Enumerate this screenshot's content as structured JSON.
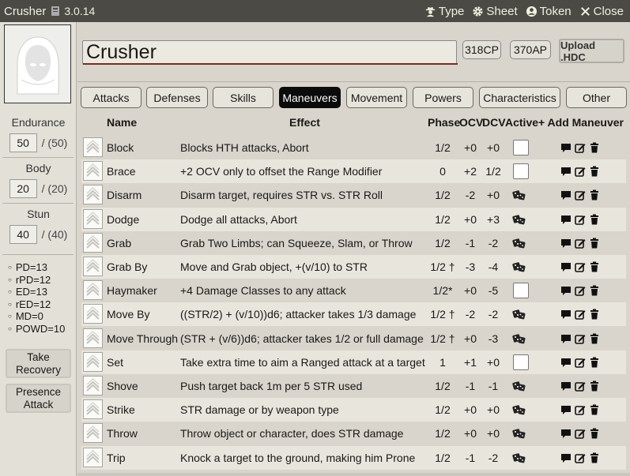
{
  "window": {
    "title": "Crusher",
    "version": "3.0.14",
    "header_buttons": [
      {
        "label": "Type",
        "icon": "user-secret-icon"
      },
      {
        "label": "Sheet",
        "icon": "gear-icon"
      },
      {
        "label": "Token",
        "icon": "user-circle-icon"
      },
      {
        "label": "Close",
        "icon": "close-icon"
      }
    ]
  },
  "sidebar": {
    "portrait_icon": "hooded-figure-icon",
    "endurance": {
      "label": "Endurance",
      "value": "50",
      "max": "/ (50)"
    },
    "body": {
      "label": "Body",
      "value": "20",
      "max": "/ (20)"
    },
    "stun": {
      "label": "Stun",
      "value": "40",
      "max": "/ (40)"
    },
    "defenses": [
      "PD=13",
      "rPD=12",
      "ED=13",
      "rED=12",
      "MD=0",
      "POWD=10"
    ],
    "take_recovery": "Take Recovery",
    "presence_attack": "Presence Attack"
  },
  "header": {
    "name": "Crusher",
    "cp": "318CP",
    "ap": "370AP",
    "upload": "Upload .HDC"
  },
  "tabs": [
    {
      "label": "Attacks",
      "active": false
    },
    {
      "label": "Defenses",
      "active": false
    },
    {
      "label": "Skills",
      "active": false
    },
    {
      "label": "Maneuvers",
      "active": true
    },
    {
      "label": "Movement",
      "active": false
    },
    {
      "label": "Powers",
      "active": false
    },
    {
      "label": "Characteristics",
      "active": false
    },
    {
      "label": "Other",
      "active": false
    }
  ],
  "table": {
    "headers": {
      "name": "Name",
      "effect": "Effect",
      "phase": "Phase",
      "ocv": "OCV",
      "dcv": "DCV",
      "active": "Active",
      "add": "+ Add Maneuver"
    },
    "rows": [
      {
        "name": "Block",
        "effect": "Blocks HTH attacks, Abort",
        "phase": "1/2",
        "ocv": "+0",
        "dcv": "+0",
        "control": "checkbox"
      },
      {
        "name": "Brace",
        "effect": "+2 OCV only to offset the Range Modifier",
        "phase": "0",
        "ocv": "+2",
        "dcv": "1/2",
        "control": "checkbox"
      },
      {
        "name": "Disarm",
        "effect": "Disarm target, requires STR vs. STR Roll",
        "phase": "1/2",
        "ocv": "-2",
        "dcv": "+0",
        "control": "dice"
      },
      {
        "name": "Dodge",
        "effect": "Dodge all attacks, Abort",
        "phase": "1/2",
        "ocv": "+0",
        "dcv": "+3",
        "control": "dice"
      },
      {
        "name": "Grab",
        "effect": "Grab Two Limbs; can Squeeze, Slam, or Throw",
        "phase": "1/2",
        "ocv": "-1",
        "dcv": "-2",
        "control": "dice"
      },
      {
        "name": "Grab By",
        "effect": "Move and Grab object, +(v/10) to STR",
        "phase": "1/2 †",
        "ocv": "-3",
        "dcv": "-4",
        "control": "dice"
      },
      {
        "name": "Haymaker",
        "effect": "+4 Damage Classes to any attack",
        "phase": "1/2*",
        "ocv": "+0",
        "dcv": "-5",
        "control": "checkbox"
      },
      {
        "name": "Move By",
        "effect": "((STR/2) + (v/10))d6; attacker takes 1/3 damage",
        "phase": "1/2 †",
        "ocv": "-2",
        "dcv": "-2",
        "control": "dice"
      },
      {
        "name": "Move Through",
        "effect": "(STR + (v/6))d6; attacker takes 1/2 or full damage",
        "phase": "1/2 †",
        "ocv": "+0",
        "dcv": "-3",
        "control": "dice"
      },
      {
        "name": "Set",
        "effect": "Take extra time to aim a Ranged attack at a target",
        "phase": "1",
        "ocv": "+1",
        "dcv": "+0",
        "control": "checkbox"
      },
      {
        "name": "Shove",
        "effect": "Push target back 1m per 5 STR used",
        "phase": "1/2",
        "ocv": "-1",
        "dcv": "-1",
        "control": "dice"
      },
      {
        "name": "Strike",
        "effect": "STR damage or by weapon type",
        "phase": "1/2",
        "ocv": "+0",
        "dcv": "+0",
        "control": "dice"
      },
      {
        "name": "Throw",
        "effect": "Throw object or character, does STR damage",
        "phase": "1/2",
        "ocv": "+0",
        "dcv": "+0",
        "control": "dice"
      },
      {
        "name": "Trip",
        "effect": "Knock a target to the ground, making him Prone",
        "phase": "1/2",
        "ocv": "-1",
        "dcv": "-2",
        "control": "dice"
      }
    ]
  },
  "colors": {
    "titlebar": "#4b4a44",
    "background": "#d9d5cc",
    "active_tab": "#0b0b0b",
    "name_underline": "#782e22"
  }
}
